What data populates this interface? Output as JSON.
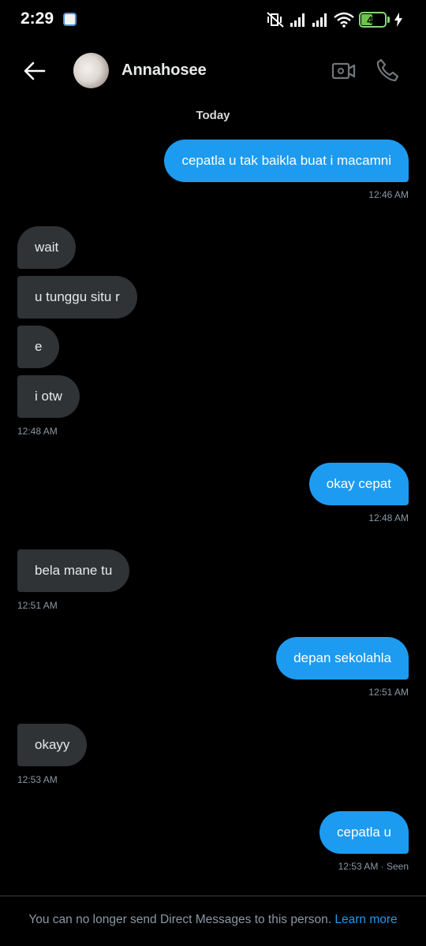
{
  "status_bar": {
    "time": "2:29",
    "battery_level": "44",
    "battery_fraction": 0.44,
    "icons": [
      "app-notification-icon",
      "mute-vibrate-icon",
      "signal-icon",
      "signal-icon",
      "wifi-icon",
      "battery-icon",
      "charging-icon"
    ]
  },
  "header": {
    "contact_name": "Annahosee",
    "icons": [
      "back-arrow-icon",
      "video-camera-icon",
      "phone-icon"
    ]
  },
  "date_separator": "Today",
  "messages": [
    {
      "side": "sent",
      "text": "cepatla u tak baikla buat i macamni",
      "time": "12:46 AM"
    },
    {
      "side": "recv",
      "text": "wait"
    },
    {
      "side": "recv",
      "text": "u tunggu situ r"
    },
    {
      "side": "recv",
      "text": "e"
    },
    {
      "side": "recv",
      "text": "i otw",
      "time": "12:48 AM"
    },
    {
      "side": "sent",
      "text": "okay cepat",
      "time": "12:48 AM"
    },
    {
      "side": "recv",
      "text": "bela mane tu",
      "time": "12:51 AM"
    },
    {
      "side": "sent",
      "text": "depan sekolahla",
      "time": "12:51 AM"
    },
    {
      "side": "recv",
      "text": "okayy",
      "time": "12:53 AM"
    },
    {
      "side": "sent",
      "text": "cepatla u",
      "time": "12:53 AM · Seen"
    }
  ],
  "footer": {
    "notice": "You can no longer send Direct Messages to this person.",
    "link": "Learn more"
  },
  "colors": {
    "background": "#000000",
    "sent_bubble": "#1d9bf0",
    "received_bubble": "#2f3336",
    "link": "#1d9bf0",
    "timestamp": "#8b98a5"
  }
}
